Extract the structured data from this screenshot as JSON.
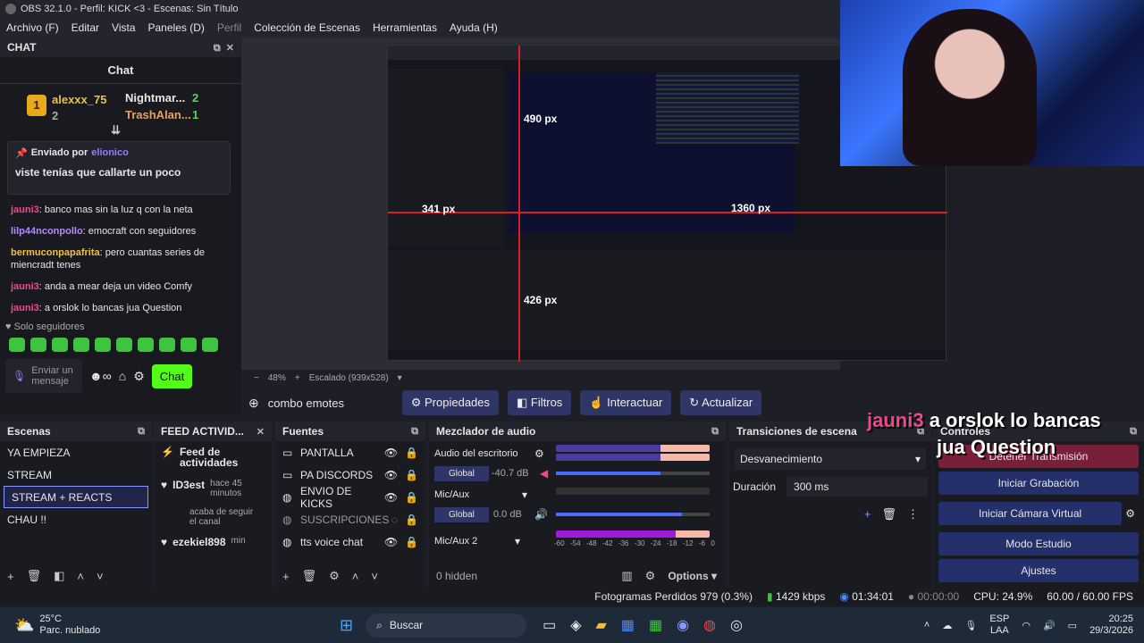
{
  "window": {
    "title": "OBS 32.1.0 - Perfil: KICK <3 - Escenas: Sin Título"
  },
  "menu": [
    "Archivo (F)",
    "Editar",
    "Vista",
    "Paneles (D)",
    "Perfil",
    "Colección de Escenas",
    "Herramientas",
    "Ayuda (H)"
  ],
  "chat": {
    "dock_title": "CHAT",
    "header": "Chat",
    "leaders": [
      {
        "name": "alexxx_75",
        "count": "2"
      },
      {
        "name": "Nightmar...",
        "count": "2"
      },
      {
        "name": "TrashAlan...",
        "count": "1"
      }
    ],
    "leader_side": "2",
    "pinned": {
      "label": "Enviado por",
      "user": "elionico",
      "text": "viste tenías que callarte un poco"
    },
    "messages": [
      {
        "user": "jauni3",
        "text": ": banco mas sin la luz q con la neta",
        "color": "#e94b8a"
      },
      {
        "user": "lilp44nconpollo",
        "text": ": emocraft con seguidores",
        "color": "#b48cff"
      },
      {
        "user": "bermuconpapafrita",
        "text": ": pero cuantas series de miencradt tenes",
        "color": "#f0c040"
      },
      {
        "user": "jauni3",
        "text": ": anda a mear deja un video Comfy",
        "color": "#e94b8a"
      },
      {
        "user": "jauni3",
        "text": ": a orslok lo bancas jua Question",
        "color": "#e94b8a"
      }
    ],
    "followers_only": "Solo seguidores",
    "input_placeholder": "Enviar un mensaje",
    "send": "Chat"
  },
  "preview": {
    "labels": {
      "h490": "490 px",
      "h341": "341 px",
      "h426": "426 px",
      "w1360": "1360 px"
    },
    "zoom": "48%",
    "scaled": "Escalado (939x528)"
  },
  "context": {
    "source": "combo emotes",
    "buttons": [
      "Propiedades",
      "Filtros",
      "Interactuar",
      "Actualizar"
    ]
  },
  "docks": {
    "scenes": {
      "title": "Escenas",
      "items": [
        "YA EMPIEZA",
        "STREAM",
        "STREAM + REACTS",
        "CHAU !!"
      ],
      "selected": 2
    },
    "feed": {
      "title": "FEED ACTIVID...",
      "header": "Feed de actividades",
      "items": [
        {
          "user": "ID3est",
          "time": "hace 45 minutos",
          "action": "acaba de seguir el canal"
        },
        {
          "user": "ezekiel898",
          "time": "min",
          "action": ""
        }
      ]
    },
    "sources": {
      "title": "Fuentes",
      "items": [
        "PANTALLA",
        "PA DISCORDS",
        "ENVIO DE KICKS",
        "SUSCRIPCIONES",
        "tts voice chat"
      ]
    },
    "mixer": {
      "title": "Mezclador de audio",
      "channels": [
        {
          "name": "Audio del escritorio",
          "db": "-40.7 dB",
          "tag": "Global",
          "level": 0.68
        },
        {
          "name": "Mic/Aux",
          "db": "0.0 dB",
          "tag": "Global",
          "level": 0.82
        },
        {
          "name": "Mic/Aux 2",
          "db": "",
          "tag": "",
          "level": 0.88
        }
      ],
      "ticks": [
        "-60",
        "-54",
        "-48",
        "-42",
        "-36",
        "-30",
        "-24",
        "-18",
        "-12",
        "-6",
        "0"
      ],
      "hidden": "0 hidden",
      "options": "Options"
    },
    "transitions": {
      "title": "Transiciones de escena",
      "selected": "Desvanecimiento",
      "duration_label": "Duración",
      "duration": "300 ms"
    },
    "controls": {
      "title": "Controles",
      "buttons": [
        "Detener Transmisión",
        "Iniciar Grabación",
        "Iniciar Cámara Virtual",
        "Modo Estudio",
        "Ajustes"
      ]
    }
  },
  "overlay": {
    "user": "jauni3",
    "line1": "a orslok lo bancas",
    "line2": "jua Question"
  },
  "status": {
    "dropped": "Fotogramas Perdidos 979 (0.3%)",
    "kbps": "1429 kbps",
    "live": "01:34:01",
    "rec": "00:00:00",
    "cpu": "CPU: 24.9%",
    "fps": "60.00 / 60.00 FPS"
  },
  "taskbar": {
    "temp": "25°C",
    "weather": "Parc. nublado",
    "search": "Buscar",
    "lang1": "ESP",
    "lang2": "LAA",
    "time": "20:25",
    "date": "29/3/2026"
  }
}
